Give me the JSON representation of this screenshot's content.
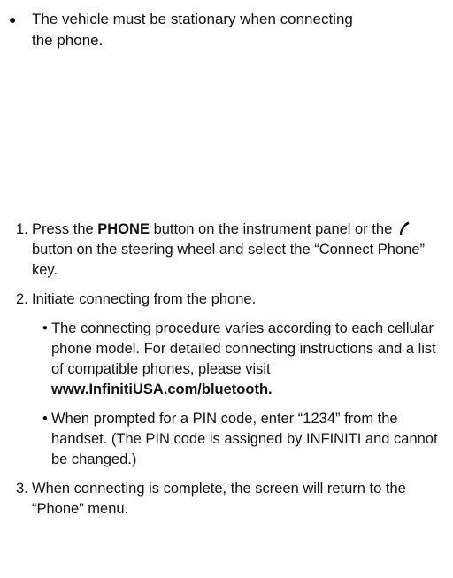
{
  "note": {
    "text_line1": "The vehicle must be stationary when connecting",
    "text_line2": "the phone."
  },
  "steps": [
    {
      "num": "1.",
      "pre": "Press the ",
      "bold": "PHONE",
      "mid": " button on the instrument panel or the ",
      "icon": "phone-handset-icon",
      "post": " button on the steering wheel and select the “Connect Phone” key."
    },
    {
      "num": "2.",
      "text": "Initiate connecting from the phone.",
      "substeps": [
        {
          "pre": "The connecting procedure varies according to each cellular phone model. For detailed connecting instructions and a list of compatible phones, please visit ",
          "bold": "www.InfinitiUSA.com/bluetooth."
        },
        {
          "text": "When prompted for a PIN code, enter “1234” from the handset. (The PIN code is assigned by INFINITI and cannot be changed.)"
        }
      ]
    },
    {
      "num": "3.",
      "text": "When connecting is complete, the screen will return to the “Phone” menu."
    }
  ]
}
